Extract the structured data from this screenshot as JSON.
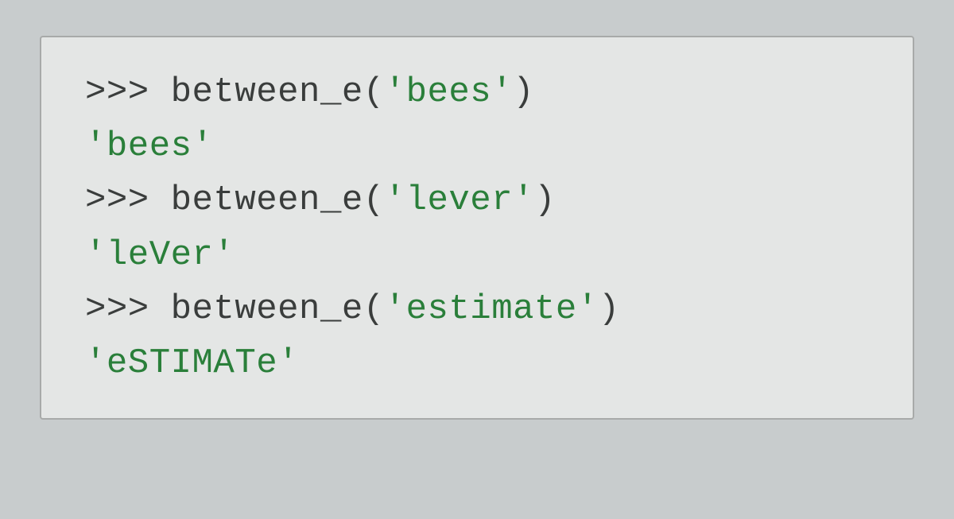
{
  "repl": {
    "prompt": ">>> ",
    "lines": [
      {
        "type": "input",
        "funcName": "between_e",
        "arg": "'bees'",
        "open": "(",
        "close": ")"
      },
      {
        "type": "output",
        "value": "'bees'"
      },
      {
        "type": "input",
        "funcName": "between_e",
        "arg": "'lever'",
        "open": "(",
        "close": ")"
      },
      {
        "type": "output",
        "value": "'leVer'"
      },
      {
        "type": "input",
        "funcName": "between_e",
        "arg": "'estimate'",
        "open": "(",
        "close": ")"
      },
      {
        "type": "output",
        "value": "'eSTIMATe'"
      }
    ]
  }
}
